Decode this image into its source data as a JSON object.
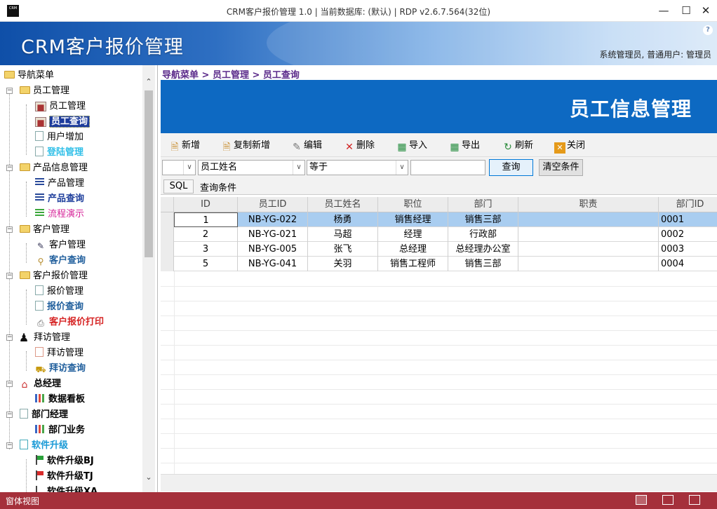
{
  "window": {
    "icon_text": "CRM",
    "title": "CRM客户报价管理 1.0 | 当前数据库: (默认) | RDP v2.6.7.564(32位)"
  },
  "banner": {
    "app_name": "CRM客户报价管理",
    "user_info": "系统管理员, 普通用户: 管理员",
    "help": "?"
  },
  "sidebar": {
    "root": "导航菜单",
    "groups": [
      {
        "label": "员工管理",
        "items": [
          "员工管理",
          "员工查询",
          "用户增加",
          "登陆管理"
        ]
      },
      {
        "label": "产品信息管理",
        "items": [
          "产品管理",
          "产品查询",
          "流程演示"
        ]
      },
      {
        "label": "客户管理",
        "items": [
          "客户管理",
          "客户查询"
        ]
      },
      {
        "label": "客户报价管理",
        "items": [
          "报价管理",
          "报价查询",
          "客户报价打印"
        ]
      },
      {
        "label": "拜访管理",
        "items": [
          "拜访管理",
          "拜访查询"
        ]
      },
      {
        "label": "总经理",
        "items": [
          "数据看板"
        ]
      },
      {
        "label": "部门经理",
        "items": [
          "部门业务"
        ]
      },
      {
        "label": "软件升级",
        "items": [
          "软件升级BJ",
          "软件升级TJ",
          "软件升级XA"
        ]
      }
    ]
  },
  "main": {
    "breadcrumb": "导航菜单 > 员工管理 > 员工查询",
    "page_title": "员工信息管理",
    "toolbar": {
      "add": "新增",
      "copy_add": "复制新增",
      "edit": "编辑",
      "delete": "删除",
      "import": "导入",
      "export": "导出",
      "refresh": "刷新",
      "close": "关闭"
    },
    "filter": {
      "field": "员工姓名",
      "operator": "等于",
      "value": "",
      "query_button": "查询",
      "clear_button": "清空条件"
    },
    "sql": {
      "button": "SQL",
      "label": "查询条件"
    },
    "grid": {
      "columns": [
        "ID",
        "员工ID",
        "员工姓名",
        "职位",
        "部门",
        "职责",
        "部门ID"
      ],
      "rows": [
        [
          "1",
          "NB-YG-022",
          "杨勇",
          "销售经理",
          "销售三部",
          "",
          "0001"
        ],
        [
          "2",
          "NB-YG-021",
          "马超",
          "经理",
          "行政部",
          "",
          "0002"
        ],
        [
          "3",
          "NB-YG-005",
          "张飞",
          "总经理",
          "总经理办公室",
          "",
          "0003"
        ],
        [
          "5",
          "NB-YG-041",
          "关羽",
          "销售工程师",
          "销售三部",
          "",
          "0004"
        ]
      ]
    }
  },
  "statusbar": {
    "text": "窗体视图"
  }
}
